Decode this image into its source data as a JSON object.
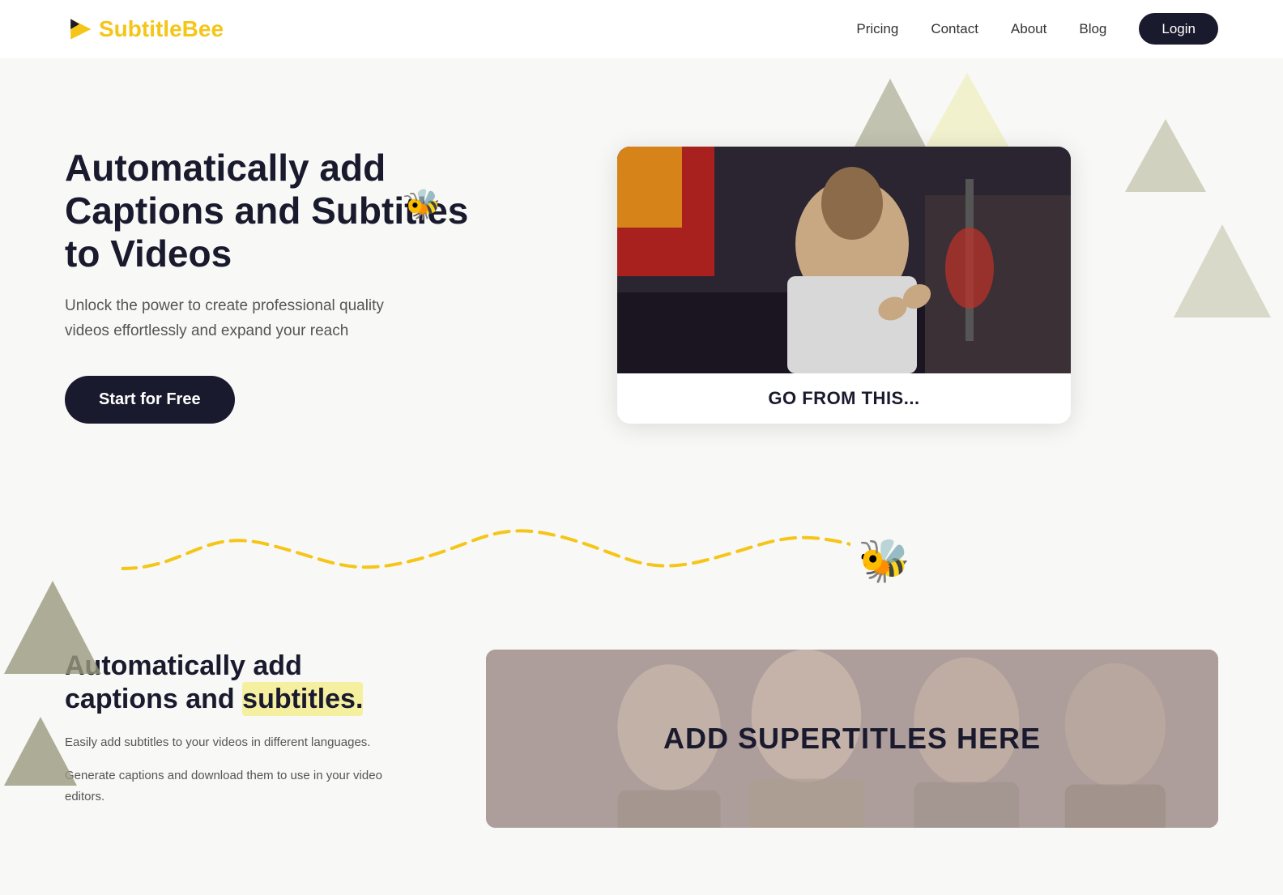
{
  "nav": {
    "logo_text_black": "Subtitle",
    "logo_text_yellow": "Bee",
    "links": [
      {
        "id": "pricing",
        "label": "Pricing",
        "href": "#"
      },
      {
        "id": "contact",
        "label": "Contact",
        "href": "#"
      },
      {
        "id": "about",
        "label": "About",
        "href": "#"
      },
      {
        "id": "blog",
        "label": "Blog",
        "href": "#"
      }
    ],
    "login_label": "Login"
  },
  "hero": {
    "title": "Automatically add Captions and Subtitles to Videos",
    "subtitle": "Unlock the power to create professional quality videos effortlessly and expand your reach",
    "cta_label": "Start for Free",
    "video_caption": "GO FROM THIS..."
  },
  "features": {
    "title_part1": "Automatically add captions and",
    "title_part2": "subtitles.",
    "desc1": "Easily add subtitles to your videos in different languages.",
    "desc2": "Generate captions and download them to use in your video editors.",
    "image_text": "ADD SUPERTITLES HERE"
  },
  "colors": {
    "dark_navy": "#1a1a2e",
    "yellow": "#f5c518",
    "yellow_light": "#f5f0a0",
    "gray_shape": "#b8b89a",
    "white": "#ffffff"
  }
}
